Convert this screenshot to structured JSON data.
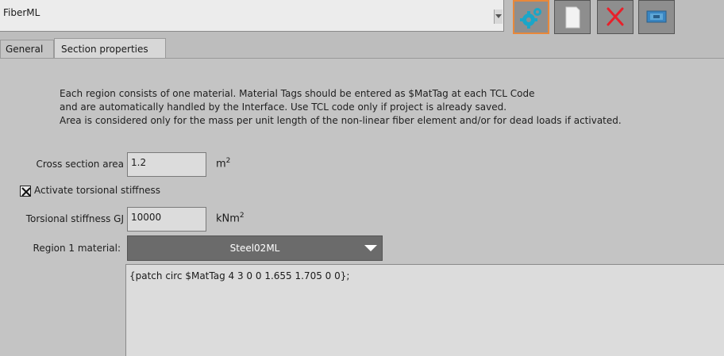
{
  "combo": {
    "value": "FiberML"
  },
  "toolbar": {
    "settings_icon": "gears-icon",
    "new_icon": "document-icon",
    "delete_icon": "delete-x-icon",
    "export_icon": "export-icon",
    "accent": "#e8883a",
    "delete_color": "#e8202a"
  },
  "tabs": [
    {
      "label": "General"
    },
    {
      "label": "Section properties"
    }
  ],
  "info": {
    "line1": "Each region consists of one material. Material Tags should be entered as $MatTag at each TCL Code",
    "line2": "and are automatically handled by the Interface. Use TCL code only if project is already saved.",
    "line3": "Area is considered only for the mass per unit length of the non-linear fiber element and/or for dead loads if activated."
  },
  "area": {
    "label": "Cross section area",
    "value": "1.2",
    "unit": "m",
    "unit_exp": "2"
  },
  "torsion_toggle": {
    "label": "Activate torsional stiffness",
    "checked": true
  },
  "torsion": {
    "label": "Torsional stiffness GJ",
    "value": "10000",
    "unit": "kNm",
    "unit_exp": "2"
  },
  "material": {
    "label": "Region 1 material:",
    "selected": "Steel02ML"
  },
  "tcl": {
    "code": "{patch circ $MatTag 4 3 0 0 1.655 1.705 0 0};"
  }
}
